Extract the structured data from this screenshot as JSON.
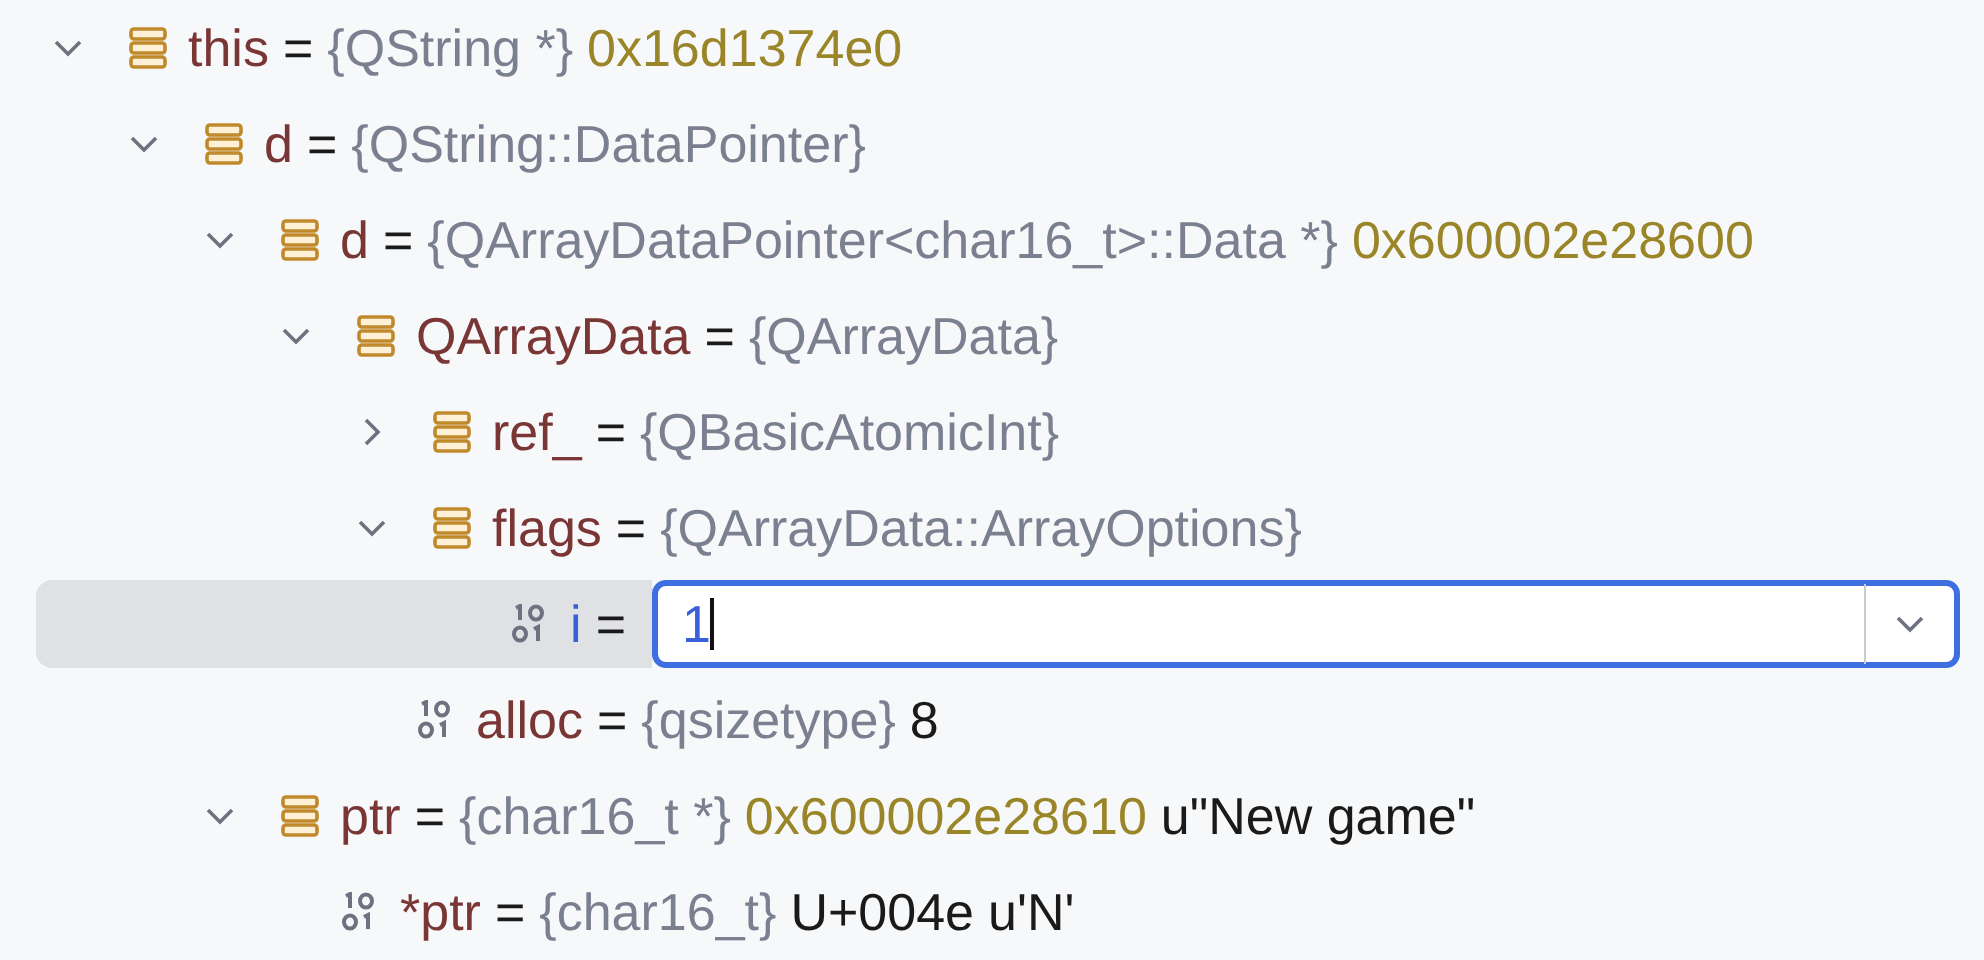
{
  "tree": [
    {
      "name": "this",
      "eq": "=",
      "type": "{QString *}",
      "kind": "struct",
      "expanded": true,
      "selected": false,
      "values": [
        {
          "text": "0x16d1374e0",
          "kind": "address"
        }
      ],
      "children": [
        {
          "name": "d",
          "eq": "=",
          "type": "{QString::DataPointer}",
          "kind": "struct",
          "expanded": true,
          "selected": false,
          "children": [
            {
              "name": "d",
              "eq": "=",
              "type": "{QArrayDataPointer<char16_t>::Data *}",
              "kind": "struct",
              "expanded": true,
              "selected": false,
              "values": [
                {
                  "text": "0x600002e28600",
                  "kind": "address"
                }
              ],
              "children": [
                {
                  "name": "QArrayData",
                  "eq": "=",
                  "type": "{QArrayData}",
                  "kind": "struct",
                  "expanded": true,
                  "selected": false,
                  "children": [
                    {
                      "name": "ref_",
                      "eq": "=",
                      "type": "{QBasicAtomicInt}",
                      "kind": "struct",
                      "expanded": false,
                      "selected": false
                    },
                    {
                      "name": "flags",
                      "eq": "=",
                      "type": "{QArrayData::ArrayOptions}",
                      "kind": "struct",
                      "expanded": true,
                      "selected": false,
                      "children": [
                        {
                          "name": "i",
                          "eq": "=",
                          "kind": "primitive",
                          "selected": true,
                          "edit_value": "1"
                        }
                      ]
                    },
                    {
                      "name": "alloc",
                      "eq": "=",
                      "type": "{qsizetype}",
                      "kind": "primitive",
                      "selected": false,
                      "values": [
                        {
                          "text": "8",
                          "kind": "plain"
                        }
                      ]
                    }
                  ]
                }
              ]
            },
            {
              "name": "ptr",
              "eq": "=",
              "type": "{char16_t *}",
              "kind": "struct",
              "expanded": true,
              "selected": false,
              "values": [
                {
                  "text": "0x600002e28610",
                  "kind": "address"
                },
                {
                  "text": "u\"New game\"",
                  "kind": "plain"
                }
              ],
              "children": [
                {
                  "name": "*ptr",
                  "eq": "=",
                  "type": "{char16_t}",
                  "kind": "primitive",
                  "selected": false,
                  "values": [
                    {
                      "text": "U+004e",
                      "kind": "plain"
                    },
                    {
                      "text": "u'N'",
                      "kind": "plain"
                    }
                  ]
                }
              ]
            }
          ]
        }
      ]
    }
  ]
}
